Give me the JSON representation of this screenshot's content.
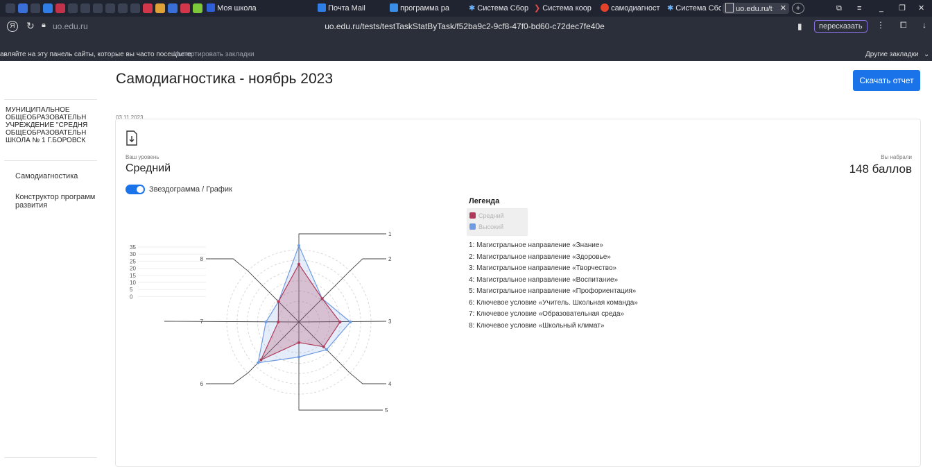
{
  "browser": {
    "tabs": [
      "Моя школа",
      "Почта Mail",
      "программа ра",
      "Система Сбор",
      "Система коор",
      "самодиагност",
      "Система Сбор",
      "uo.edu.ru/t"
    ],
    "url_domain": "uo.edu.ru",
    "url": "uo.edu.ru/tests/testTaskStatByTask/f52ba9c2-9cf8-47f0-bd60-c72dec7fe40e",
    "retell_button": "пересказать",
    "bookmarks_hint": "авляйте на эту панель сайты, которые вы часто посещаете.",
    "import_bookmarks": "Импортировать закладки",
    "other_bookmarks": "Другие закладки"
  },
  "sidebar": {
    "org_name": "МУНИЦИПАЛЬНОЕ ОБЩЕОБРАЗОВАТЕЛЬН УЧРЕЖДЕНИЕ \"СРЕДНЯ ОБЩЕОБРАЗОВАТЕЛЬН ШКОЛА № 1 Г.БОРОВСК",
    "items": [
      {
        "label": "Самодиагностика"
      },
      {
        "label": "Конструктор программ развития"
      }
    ]
  },
  "page": {
    "title": "Самодиагностика - ноябрь 2023",
    "date": "03.11.2023",
    "download_button": "Скачать отчет",
    "level_caption": "Ваш уровень",
    "level_value": "Средний",
    "score_caption": "Вы набрали",
    "score_value": "148 баллов",
    "toggle_label": "Звездограмма / График"
  },
  "legend": {
    "title": "Легенда",
    "series": [
      {
        "name": "Средний",
        "color": "#b03a5b"
      },
      {
        "name": "Высокий",
        "color": "#6f9be3"
      }
    ],
    "axes": [
      "1: Магистральное направление «Знание»",
      "2: Магистральное направление «Здоровье»",
      "3: Магистральное направление «Творчество»",
      "4: Магистральное направление «Воспитание»",
      "5: Магистральное направление «Профориентация»",
      "6: Ключевое условие «Учитель. Школьная команда»",
      "7: Ключевое условие «Образовательная среда»",
      "8: Ключевое условие «Школьный климат»"
    ]
  },
  "chart_data": {
    "type": "radar",
    "categories": [
      "1",
      "2",
      "3",
      "4",
      "5",
      "6",
      "7",
      "8"
    ],
    "ticks": [
      "35",
      "30",
      "25",
      "20",
      "15",
      "10",
      "5",
      "0"
    ],
    "rlim": [
      0,
      35
    ],
    "series": [
      {
        "name": "Средний",
        "values": [
          28,
          16,
          20,
          17,
          10,
          26,
          10,
          14
        ],
        "color": "#b03a5b"
      },
      {
        "name": "Высокий",
        "values": [
          37,
          16,
          25,
          19,
          17,
          28,
          16,
          14
        ],
        "color": "#6f9be3"
      }
    ]
  }
}
